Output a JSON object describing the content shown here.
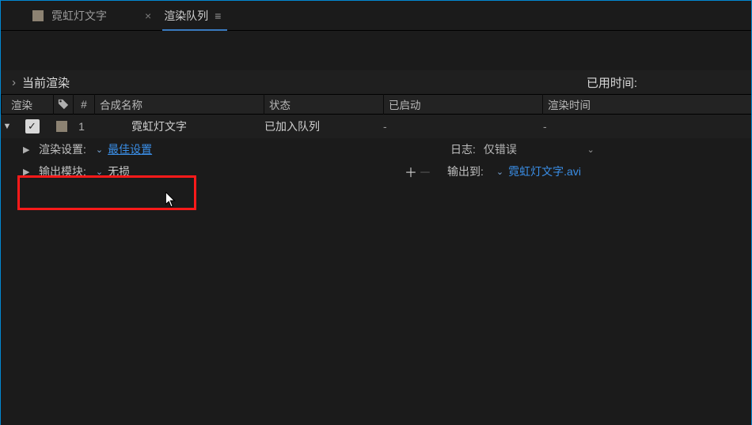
{
  "tabs": {
    "project": {
      "label": "霓虹灯文字"
    },
    "renderQueue": {
      "label": "渲染队列"
    }
  },
  "currentRender": {
    "label": "当前渲染",
    "elapsedLabel": "已用时间:"
  },
  "headers": {
    "render": "渲染",
    "num": "#",
    "comp": "合成名称",
    "status": "状态",
    "started": "已启动",
    "renderTime": "渲染时间"
  },
  "item": {
    "index": "1",
    "compName": "霓虹灯文字",
    "status": "已加入队列",
    "started": "-",
    "renderTime": "-"
  },
  "renderSettings": {
    "label": "渲染设置:",
    "value": "最佳设置",
    "logLabel": "日志:",
    "logValue": "仅错误"
  },
  "outputModule": {
    "label": "输出模块:",
    "value": "无损",
    "outputToLabel": "输出到:",
    "outputToValue": "霓虹灯文字.avi"
  }
}
